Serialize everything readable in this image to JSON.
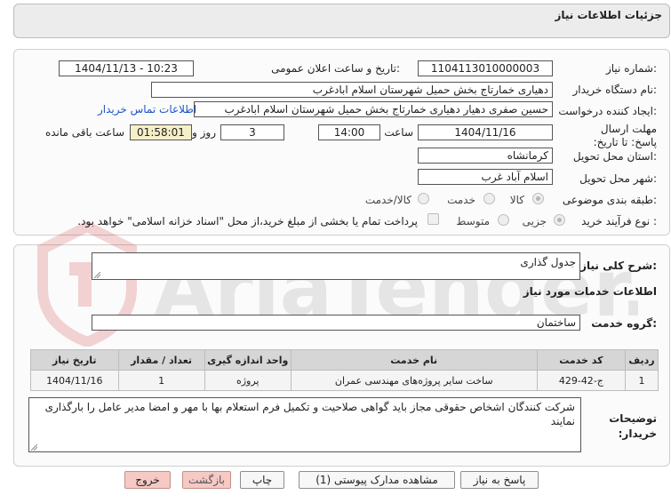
{
  "header": {
    "title": "جزئیات اطلاعات نیاز"
  },
  "form": {
    "need_number_label": "شماره نیاز:",
    "need_number": "1104113010000003",
    "announce_label": "تاریخ و ساعت اعلان عمومی:",
    "announce_value": "1404/11/13 - 10:23",
    "buyer_org_label": "نام دستگاه خریدار:",
    "buyer_org": "دهیاری خمارتاج بخش حمیل شهرستان اسلام ابادغرب",
    "creator_label": "ایجاد کننده درخواست:",
    "creator": "حسین صفری دهیار دهیاری خمارتاج بخش حمیل شهرستان اسلام ابادغرب",
    "contact_link": "اطلاعات تماس خریدار",
    "deadline_label": "مهلت ارسال پاسخ: تا تاریخ:",
    "deadline_date": "1404/11/16",
    "time_label": "ساعت",
    "deadline_time": "14:00",
    "days_value": "3",
    "days_label": "روز و",
    "remaining_time": "01:58:01",
    "remaining_label": "ساعت باقی مانده",
    "province_label": "استان محل تحویل:",
    "province": "کرمانشاه",
    "city_label": "شهر محل تحویل:",
    "city": "اسلام آباد غرب",
    "category_label": "طبقه بندی موضوعی:",
    "category_options": [
      "کالا",
      "خدمت",
      "کالا/خدمت"
    ],
    "process_label": "نوع فرآیند خرید :",
    "process_options": [
      "جزیی",
      "متوسط"
    ],
    "payment_note": "پرداخت تمام یا بخشی از مبلغ خرید،از محل \"اسناد خزانه اسلامی\" خواهد بود."
  },
  "details": {
    "summary_label": "شرح کلی نیاز:",
    "summary": "جدول گذاری",
    "services_heading": "اطلاعات خدمات مورد نیاز",
    "service_group_label": "گروه خدمت:",
    "service_group": "ساختمان",
    "table_headers": [
      "ردیف",
      "کد خدمت",
      "نام خدمت",
      "واحد اندازه گیری",
      "تعداد / مقدار",
      "تاریخ نیاز"
    ],
    "table_rows": [
      [
        "1",
        "ج-42-429",
        "ساخت سایر پروژه‌های مهندسی عمران",
        "پروژه",
        "1",
        "1404/11/16"
      ]
    ],
    "buyer_notes_label": "توضیحات خریدار:",
    "buyer_notes": "شرکت کنندگان اشخاص حقوقی مجاز باید گواهی صلاحیت و تکمیل فرم استعلام بها با مهر و امضا مدیر عامل را بارگذاری نمایند"
  },
  "buttons": {
    "reply": "پاسخ به نیاز",
    "attachments": "مشاهده مدارک پیوستی (1)",
    "print": "چاپ",
    "back": "بازگشت",
    "exit": "خروج"
  },
  "watermark": {
    "text": "AriaTender.neT"
  }
}
